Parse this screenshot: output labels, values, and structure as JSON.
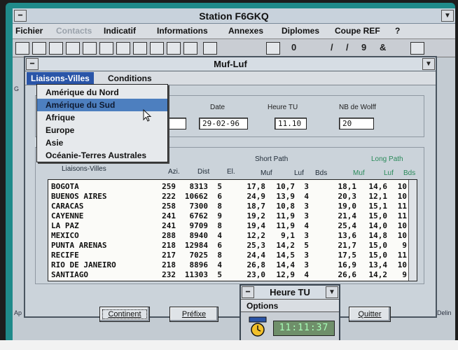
{
  "window": {
    "title": "Station F6GKQ"
  },
  "main_menu": {
    "items": [
      "Fichier",
      "Contacts",
      "Indicatif",
      "Informations",
      "Annexes",
      "Diplomes",
      "Coupe REF",
      "?"
    ],
    "disabled": [
      "Contacts"
    ]
  },
  "toolbar": {
    "glyphs": [
      "0",
      "/",
      "/",
      "9",
      "&"
    ]
  },
  "sidebar_fragments": {
    "left_top": "G",
    "left_bottom": "Ap",
    "right_bottom": "Delin"
  },
  "dialog": {
    "title": "Muf-Luf",
    "menu": {
      "liaisons_villes": "Liaisons-Villes",
      "conditions": "Conditions"
    },
    "dropdown_items": [
      "Amérique du Nord",
      "Amérique du Sud",
      "Afrique",
      "Europe",
      "Asie",
      "Océanie-Terres Australes"
    ],
    "dropdown_selected_index": 1,
    "fields": {
      "date_label": "Date",
      "date_value": "29-02-96",
      "heure_label": "Heure TU",
      "heure_value": "11.10",
      "wolf_label": "NB de Wolff",
      "wolf_value": "20"
    },
    "table": {
      "headers": {
        "ville": "Liaisons-Villes",
        "azi": "Azi.",
        "dist": "Dist",
        "el": "El.",
        "short_path": "Short Path",
        "long_path": "Long Path",
        "muf": "Muf",
        "luf": "Luf",
        "bds": "Bds"
      },
      "rows": [
        [
          "BOGOTA",
          "259",
          "8313",
          "5",
          "17,8",
          "10,7",
          "3",
          "18,1",
          "14,6",
          "10"
        ],
        [
          "BUENOS AIRES",
          "222",
          "10662",
          "6",
          "24,9",
          "13,9",
          "4",
          "20,3",
          "12,1",
          "10"
        ],
        [
          "CARACAS",
          "258",
          "7300",
          "8",
          "18,7",
          "10,8",
          "3",
          "19,0",
          "15,1",
          "11"
        ],
        [
          "CAYENNE",
          "241",
          "6762",
          "9",
          "19,2",
          "11,9",
          "3",
          "21,4",
          "15,0",
          "11"
        ],
        [
          "LA PAZ",
          "241",
          "9709",
          "8",
          "19,4",
          "11,9",
          "4",
          "25,4",
          "14,0",
          "10"
        ],
        [
          "MEXICO",
          "288",
          "8940",
          "4",
          "12,2",
          "9,1",
          "3",
          "13,6",
          "14,8",
          "10"
        ],
        [
          "PUNTA ARENAS",
          "218",
          "12984",
          "6",
          "25,3",
          "14,2",
          "5",
          "21,7",
          "15,0",
          "9"
        ],
        [
          "RECIFE",
          "217",
          "7025",
          "8",
          "24,4",
          "14,5",
          "3",
          "17,5",
          "15,0",
          "11"
        ],
        [
          "RIO DE JANEIRO",
          "218",
          "8896",
          "4",
          "26,8",
          "14,4",
          "3",
          "16,9",
          "13,4",
          "10"
        ],
        [
          "SANTIAGO",
          "232",
          "11303",
          "5",
          "23,0",
          "12,9",
          "4",
          "26,6",
          "14,2",
          "9"
        ]
      ]
    },
    "buttons": {
      "continent": "Continent",
      "prefixe": "Préfixe",
      "quitter": "Quitter"
    }
  },
  "heure_window": {
    "title": "Heure TU",
    "menu": "Options",
    "time": "11:11:37"
  },
  "colors": {
    "desktop": "#1f8a8a",
    "selection": "#4d7fbf",
    "menu_active": "#2a55a8",
    "long_path_header": "#2a8a5a",
    "lcd_background": "#6f8f6a",
    "lcd_text": "#a8ffb8"
  },
  "icons": [
    "system-menu-icon",
    "minimize-icon",
    "clock-icon",
    "mouse-pointer-icon"
  ]
}
